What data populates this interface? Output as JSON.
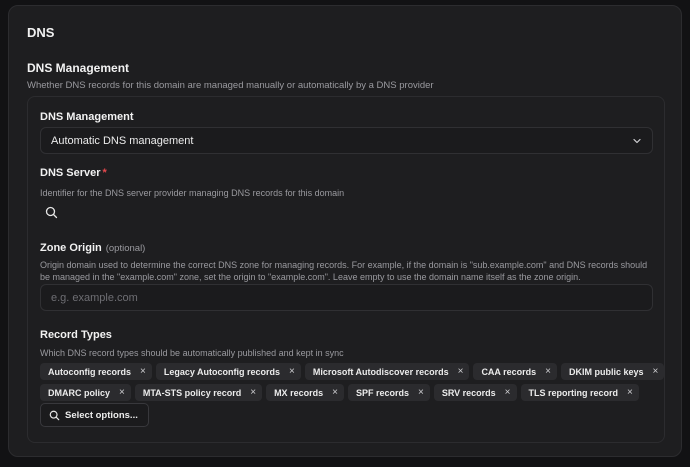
{
  "card": {
    "title": "DNS"
  },
  "section": {
    "title": "DNS Management",
    "description": "Whether DNS records for this domain are managed manually or automatically by a DNS provider"
  },
  "dns_management": {
    "label": "DNS Management",
    "value": "Automatic DNS management"
  },
  "dns_server": {
    "label": "DNS Server",
    "required_marker": "*",
    "description": "Identifier for the DNS server provider managing DNS records for this domain"
  },
  "zone_origin": {
    "label": "Zone Origin",
    "optional_label": "(optional)",
    "description": "Origin domain used to determine the correct DNS zone for managing records. For example, if the domain is \"sub.example.com\" and DNS records should be managed in the \"example.com\" zone, set the origin to \"example.com\". Leave empty to use the domain name itself as the zone origin.",
    "placeholder": "e.g. example.com",
    "value": ""
  },
  "record_types": {
    "label": "Record Types",
    "description": "Which DNS record types should be automatically published and kept in sync",
    "chips": [
      "Autoconfig records",
      "Legacy Autoconfig records",
      "Microsoft Autodiscover records",
      "CAA records",
      "DKIM public keys",
      "DMARC policy",
      "MTA-STS policy record",
      "MX records",
      "SPF records",
      "SRV records",
      "TLS reporting record"
    ],
    "remove_glyph": "×",
    "select_button": "Select options..."
  },
  "colors": {
    "background": "#121214",
    "card": "#1e1e20",
    "border": "#2c2c2f",
    "chip": "#2b2b2e",
    "required": "#e5484d",
    "muted_text": "#9a9a9f"
  },
  "icons": {
    "dropdown": "chevron-down-icon",
    "search": "search-icon",
    "remove": "close-icon"
  }
}
